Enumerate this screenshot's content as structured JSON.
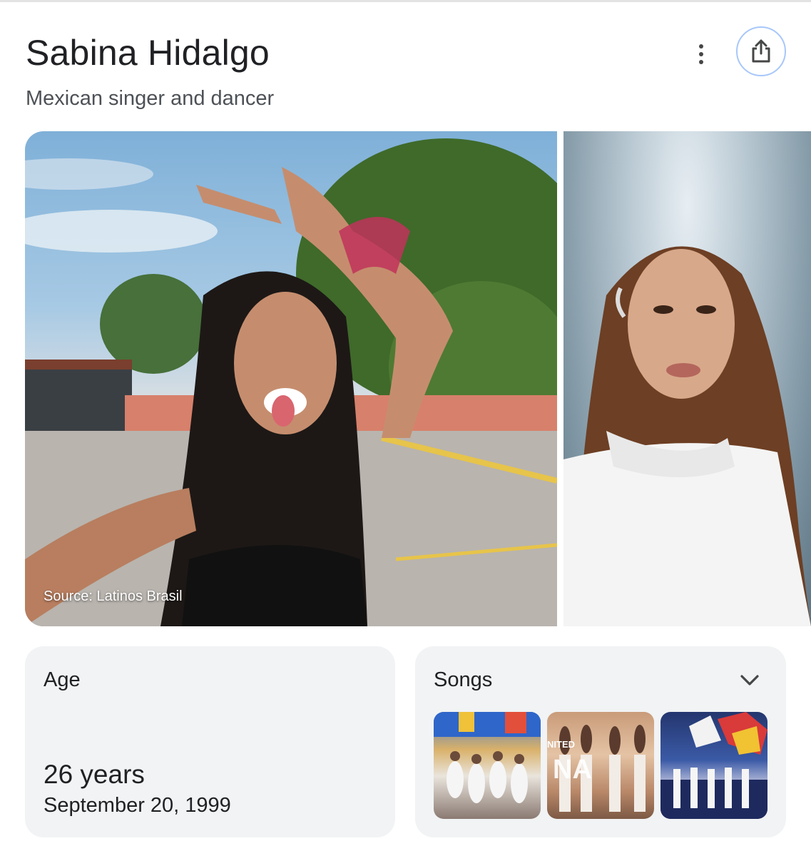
{
  "header": {
    "title": "Sabina Hidalgo",
    "subtitle": "Mexican singer and dancer"
  },
  "gallery": {
    "photo1_source": "Source: Latinos Brasil"
  },
  "age_card": {
    "label": "Age",
    "value": "26 years",
    "date": "September 20, 1999"
  },
  "songs_card": {
    "label": "Songs",
    "thumb3_text": "NA",
    "thumb2_text": "NITED"
  },
  "icons": {
    "more": "more-vert-icon",
    "share": "share-icon",
    "expand": "chevron-down-icon"
  },
  "colors": {
    "card_bg": "#f1f3f4",
    "share_border": "#a8c7fa",
    "title": "#202124",
    "subtitle": "#4d5156"
  }
}
